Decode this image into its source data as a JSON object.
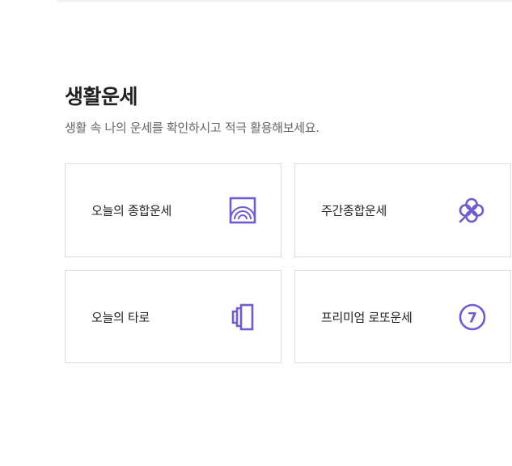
{
  "section": {
    "title": "생활운세",
    "description": "생활 속 나의 운세를 확인하시고 적극 활용해보세요."
  },
  "cards": [
    {
      "label": "오늘의 종합운세",
      "icon": "sunrise-frame-icon"
    },
    {
      "label": "주간종합운세",
      "icon": "clover-icon"
    },
    {
      "label": "오늘의 타로",
      "icon": "tarot-cards-icon"
    },
    {
      "label": "프리미엄 로또운세",
      "icon": "lotto-number-seven-icon",
      "icon_text": "7"
    }
  ],
  "colors": {
    "accent": "#6f5bd3",
    "border": "#dcdcdc",
    "title": "#222222",
    "description": "#666666"
  }
}
